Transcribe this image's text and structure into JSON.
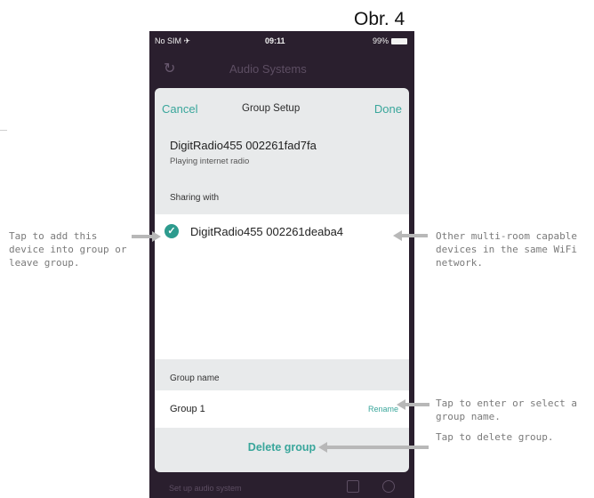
{
  "figure_label": "Obr. 4",
  "status_bar": {
    "carrier": "No SIM ✈",
    "time": "09:11",
    "battery": "99%"
  },
  "background_header": {
    "title": "Audio Systems"
  },
  "sheet": {
    "cancel_label": "Cancel",
    "title": "Group Setup",
    "done_label": "Done",
    "device_name": "DigitRadio455 002261fad7fa",
    "device_status": "Playing internet radio",
    "sharing_label": "Sharing with",
    "sharing_items": [
      {
        "name": "DigitRadio455 002261deaba4",
        "checked": true
      }
    ],
    "group_name_label": "Group name",
    "group_name_value": "Group 1",
    "rename_label": "Rename",
    "delete_label": "Delete group"
  },
  "bottom_bar": {
    "left_label": "Set up audio system"
  },
  "annotations": {
    "left": "Tap to add this device into group or leave group.",
    "right_devices": "Other multi-room capable devices in the same WiFi network.",
    "right_group_name": "Tap to enter or select a group name.",
    "right_delete": "Tap to delete group."
  },
  "colors": {
    "accent": "#39a69b",
    "check": "#2d9b8e",
    "phone_bg": "#2a1f2e",
    "sheet_bg": "#e8eaeb",
    "annotation": "#7a7a7a"
  }
}
